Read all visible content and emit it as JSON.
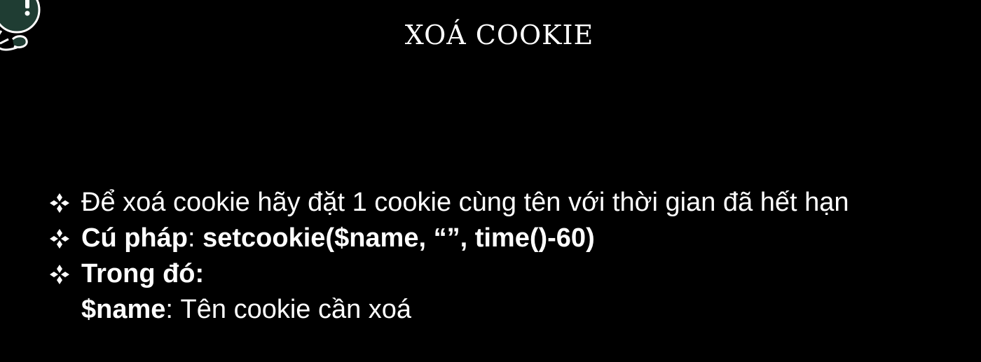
{
  "title": "XOÁ COOKIE",
  "logo": {
    "icon": "mascot-logo-icon"
  },
  "bullet_icon": "four-diamond-bullet-icon",
  "bullets": [
    {
      "text": "Để xoá cookie hãy đặt 1 cookie cùng tên với thời gian đã hết hạn"
    },
    {
      "label": "Cú pháp",
      "separator": ": ",
      "code": "setcookie($name, “”, time()-60)"
    },
    {
      "label": "Trong đó:"
    }
  ],
  "detail": {
    "term": "$name",
    "separator": ": ",
    "text": "Tên cookie cần xoá"
  },
  "colors": {
    "background": "#000000",
    "text": "#ffffff",
    "logo_fill": "#1f3d33"
  }
}
